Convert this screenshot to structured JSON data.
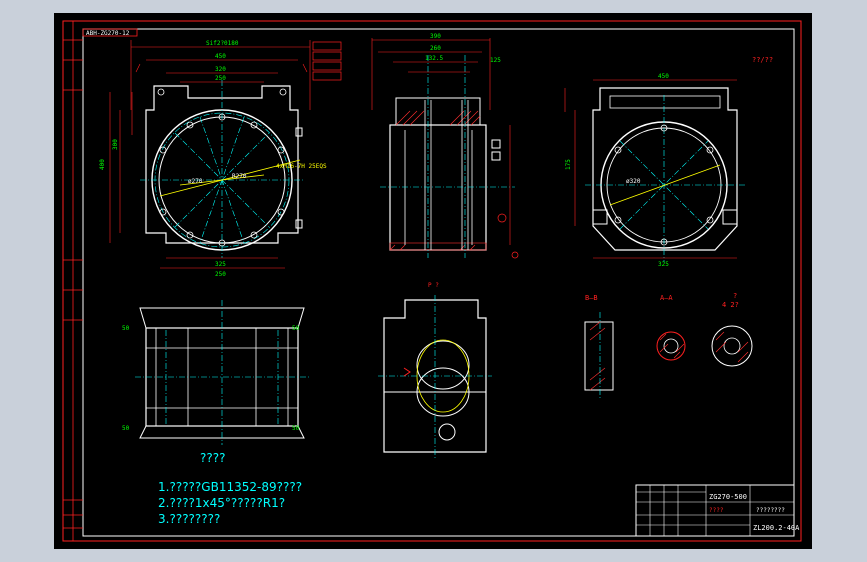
{
  "colors": {
    "bg": "#000000",
    "line": "#ffffff",
    "dim": "#ff2020",
    "center": "#00ffff",
    "hatch": "#ff3030",
    "text": "#00ffff",
    "yellow": "#ffff00",
    "green": "#00ff00",
    "frame": "#ff2020",
    "chrome": "#c9d0da"
  },
  "labels": {
    "corner_code": "ABH-ZG270-12",
    "tech_title": "????",
    "notes": [
      "1.?????GB11352-89????",
      "2.????1x45°?????R1?",
      "3.????????"
    ],
    "title_model": "ZG270-500",
    "title_name": "????????",
    "title_code": "ZL200.2-40A",
    "title_small": "????",
    "roughness": "??/??",
    "section_bb": "B—B",
    "section_aa": "A—A",
    "view_p": "P  ?",
    "view_q": "?",
    "view_q2": "4 2?",
    "dims": {
      "d1": "Sif2?0180",
      "d2": "450",
      "d3": "320",
      "d4": "250",
      "d5": "400",
      "d6": "300",
      "d7": "325",
      "d8": "250",
      "d9": "120",
      "d10": "390",
      "d11": "260",
      "d12": "132.5",
      "d13": "125",
      "d14": "450",
      "d15": "325",
      "d16": "175",
      "d17": "4xM16-7H 25EQS",
      "d18": "R270",
      "d19": "ø270",
      "d20": "ø320",
      "d21": "50",
      "d22": "130",
      "d23": "380",
      "d24": "220",
      "d25": "3300"
    }
  }
}
